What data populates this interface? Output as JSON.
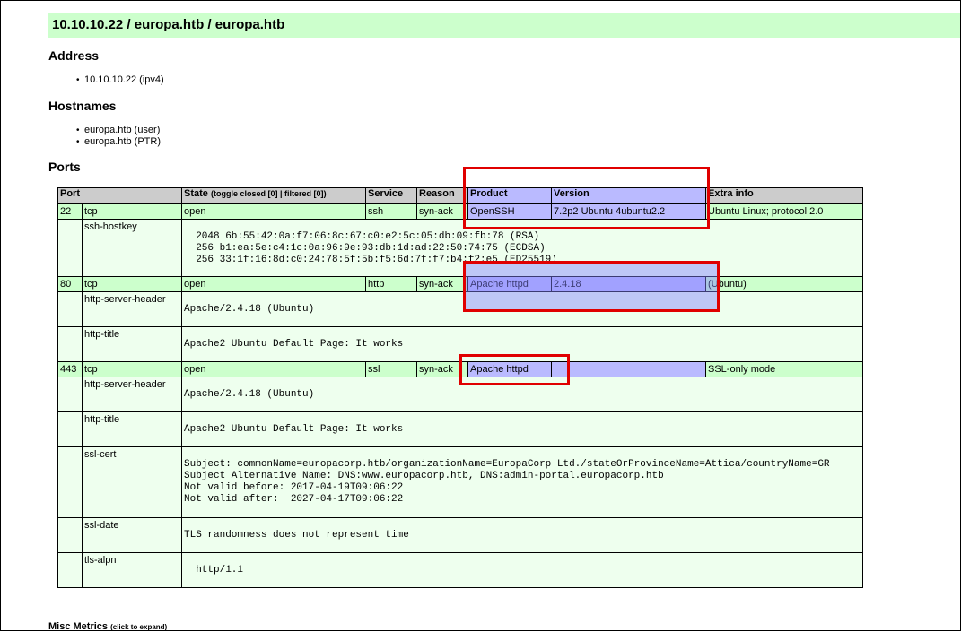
{
  "title": "10.10.10.22 / europa.htb / europa.htb",
  "address": {
    "heading": "Address",
    "items": [
      "10.10.10.22 (ipv4)"
    ]
  },
  "hostnames": {
    "heading": "Hostnames",
    "items": [
      "europa.htb (user)",
      "europa.htb (PTR)"
    ]
  },
  "ports": {
    "heading": "Ports",
    "columns": {
      "port": "Port",
      "state": "State",
      "toggle_closed": "toggle closed [0]",
      "separator": "|",
      "filtered": "filtered [0]",
      "service": "Service",
      "reason": "Reason",
      "product": "Product",
      "version": "Version",
      "extra": "Extra info"
    },
    "rows": [
      {
        "port": "22",
        "proto": "tcp",
        "state": "open",
        "service": "ssh",
        "reason": "syn-ack",
        "product": "OpenSSH",
        "version": "7.2p2 Ubuntu 4ubuntu2.2",
        "extra": "Ubuntu Linux; protocol 2.0",
        "scripts": [
          {
            "name": "ssh-hostkey",
            "output": "\n  2048 6b:55:42:0a:f7:06:8c:67:c0:e2:5c:05:db:09:fb:78 (RSA)\n  256 b1:ea:5e:c4:1c:0a:96:9e:93:db:1d:ad:22:50:74:75 (ECDSA)\n  256 33:1f:16:8d:c0:24:78:5f:5b:f5:6d:7f:f7:b4:f2:e5 (ED25519)"
          }
        ]
      },
      {
        "port": "80",
        "proto": "tcp",
        "state": "open",
        "service": "http",
        "reason": "syn-ack",
        "product": "Apache httpd",
        "version": "2.4.18",
        "extra": "(Ubuntu)",
        "scripts": [
          {
            "name": "http-server-header",
            "output": "\nApache/2.4.18 (Ubuntu)"
          },
          {
            "name": "http-title",
            "output": "\nApache2 Ubuntu Default Page: It works"
          }
        ]
      },
      {
        "port": "443",
        "proto": "tcp",
        "state": "open",
        "service": "ssl",
        "reason": "syn-ack",
        "product": "Apache httpd",
        "version": "",
        "extra": "SSL-only mode",
        "scripts": [
          {
            "name": "http-server-header",
            "output": "\nApache/2.4.18 (Ubuntu)"
          },
          {
            "name": "http-title",
            "output": "\nApache2 Ubuntu Default Page: It works"
          },
          {
            "name": "ssl-cert",
            "output": "\nSubject: commonName=europacorp.htb/organizationName=EuropaCorp Ltd./stateOrProvinceName=Attica/countryName=GR\nSubject Alternative Name: DNS:www.europacorp.htb, DNS:admin-portal.europacorp.htb\nNot valid before: 2017-04-19T09:06:22\nNot valid after:  2027-04-17T09:06:22"
          },
          {
            "name": "ssl-date",
            "output": "\nTLS randomness does not represent time"
          },
          {
            "name": "tls-alpn",
            "output": "\n  http/1.1"
          }
        ]
      }
    ]
  },
  "misc": {
    "label": "Misc Metrics",
    "hint": "(click to expand)"
  },
  "colors": {
    "title_bg": "#ccffcc",
    "port_row_bg": "#ccffcc",
    "script_row_bg": "#eeffee",
    "header_bg": "#cccccc",
    "highlight": "#8282ff",
    "annotation_red": "#e00000"
  }
}
